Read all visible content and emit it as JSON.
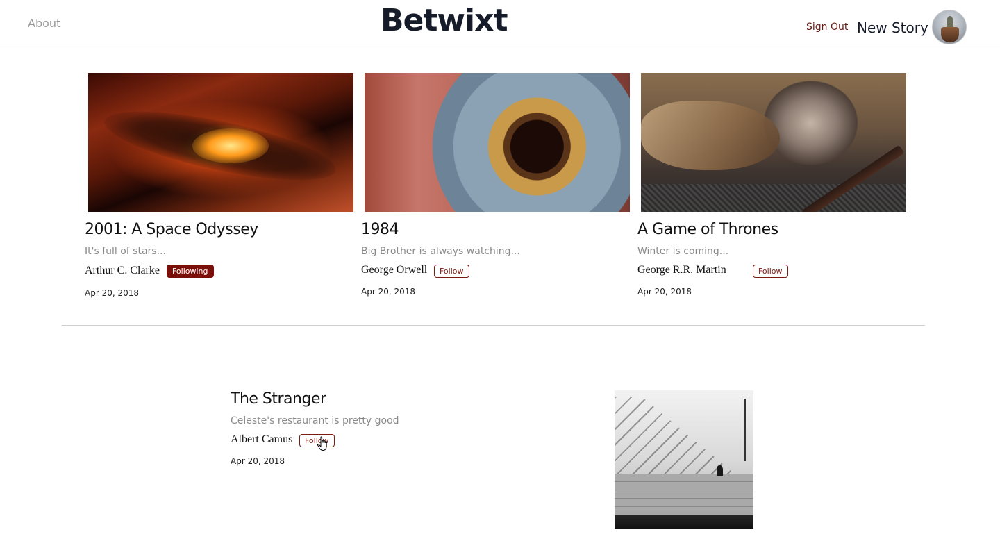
{
  "header": {
    "about": "About",
    "brand": "Betwixt",
    "sign_out": "Sign Out",
    "new_story": "New Story"
  },
  "stories": [
    {
      "title": "2001: A Space Odyssey",
      "subtitle": "It's full of stars...",
      "author": "Arthur C. Clarke",
      "follow_label": "Following",
      "date": "Apr 20, 2018"
    },
    {
      "title": "1984",
      "subtitle": "Big Brother is always watching...",
      "author": "George Orwell",
      "follow_label": "Follow",
      "date": "Apr 20, 2018"
    },
    {
      "title": "A Game of Thrones",
      "subtitle": "Winter is coming...",
      "author": "George R.R. Martin",
      "follow_label": "Follow",
      "date": "Apr 20, 2018"
    }
  ],
  "featured": {
    "title": "The Stranger",
    "subtitle": "Celeste's restaurant is pretty good",
    "author": "Albert Camus",
    "follow_label": "Follow",
    "date": "Apr 20, 2018"
  },
  "colors": {
    "accent": "#7a0f0a",
    "brand_text": "#161b2a",
    "muted_text": "#8a8a8a"
  }
}
